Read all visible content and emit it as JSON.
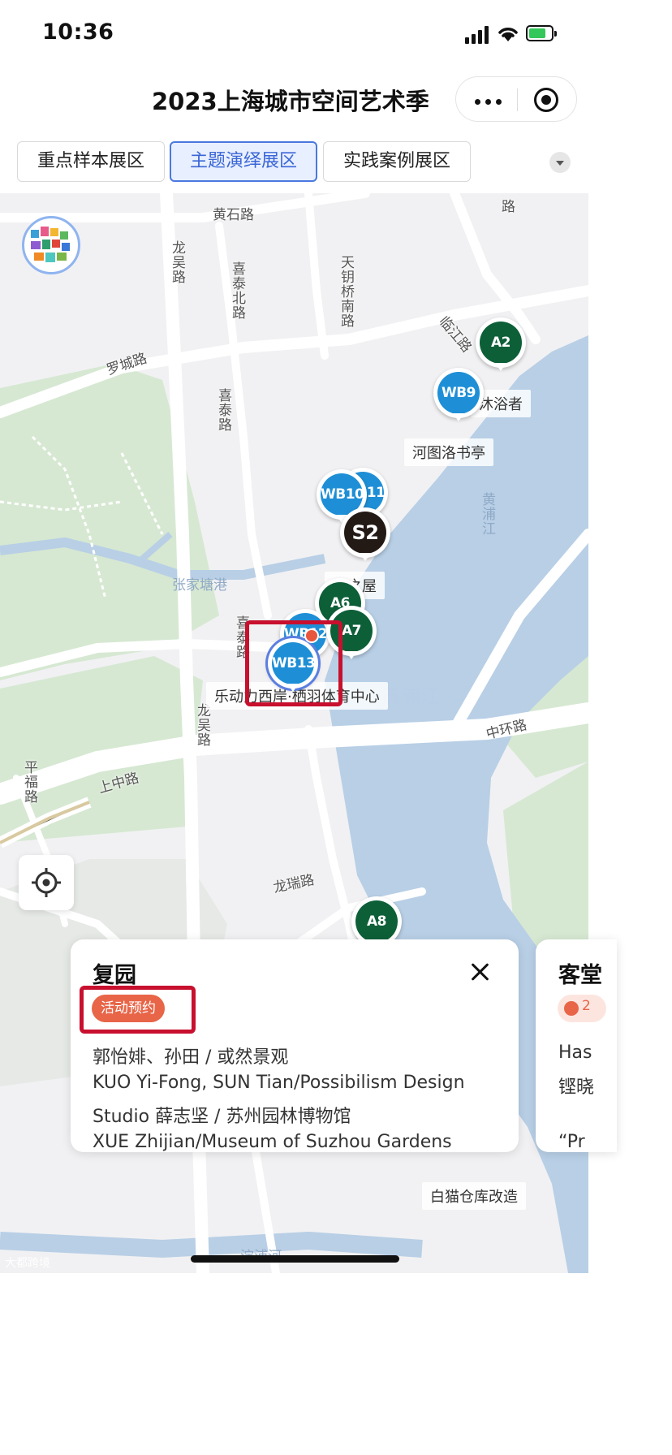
{
  "status_bar": {
    "time": "10:36"
  },
  "header": {
    "title": "2023上海城市空间艺术季"
  },
  "tabs": [
    {
      "label": "重点样本展区",
      "active": false
    },
    {
      "label": "主题演绎展区",
      "active": true
    },
    {
      "label": "实践案例展区",
      "active": false
    }
  ],
  "map": {
    "roads": {
      "huangshi": "黄石路",
      "longwu_top": "龙吴路",
      "xitai_north": "喜泰北路",
      "tianyao": "天钥桥南路",
      "lujiang": "临江路",
      "luocheng": "罗城路",
      "xitai": "喜泰路",
      "xitai_south": "喜泰路",
      "longwu_bottom": "龙吴路",
      "pingfu": "平福路",
      "shangzhong": "上中路",
      "zhonghuan": "中环路",
      "longrui": "龙瑞路",
      "top_right": "路",
      "huangpu_vertical": "黄浦江",
      "canal": "淀浦河",
      "creek": "张家塘港"
    },
    "river_label": "黄浦江",
    "places": {
      "bathers": "沐浴者",
      "hetu": "河图洛书亭",
      "shi_wu": "石之屋",
      "lelidong": "乐动力西岸·栖羽体育中心",
      "baimao": "白猫仓库改造"
    },
    "markers": [
      {
        "label": "A2",
        "color": "#0d5f38"
      },
      {
        "label": "WB9",
        "color": "#1e8fd6"
      },
      {
        "label": "WB11",
        "color": "#1e8fd6"
      },
      {
        "label": "WB10",
        "color": "#1e8fd6"
      },
      {
        "label": "S2",
        "color": "#231a16"
      },
      {
        "label": "A6",
        "color": "#0d5f38"
      },
      {
        "label": "WB12",
        "color": "#1e8fd6"
      },
      {
        "label": "A7",
        "color": "#0d5f38"
      },
      {
        "label": "WB13",
        "color": "#1e8fd6",
        "selected": true
      },
      {
        "label": "A8",
        "color": "#0d5f38"
      }
    ],
    "colors": {
      "water": "#b8cfe6",
      "green": "#d6e8d2",
      "land": "#f1f1f3",
      "road": "#ffffff"
    }
  },
  "card": {
    "title": "复园",
    "badge": "活动预约",
    "lines": [
      "郭怡婔、孙田 / 或然景观",
      "KUO Yi-Fong, SUN Tian/Possibilism Design",
      "Studio 薛志坚 / 苏州园林博物馆",
      "XUE Zhijian/Museum of Suzhou Gardens"
    ]
  },
  "card2": {
    "title": "客堂",
    "badge": "2",
    "lines": [
      "Has",
      "铿晓",
      "“Pr"
    ]
  },
  "watermark": "大都跨境",
  "colors": {
    "accent": "#3a66d6",
    "highlight": "#c8102e",
    "badge": "#e86548"
  }
}
